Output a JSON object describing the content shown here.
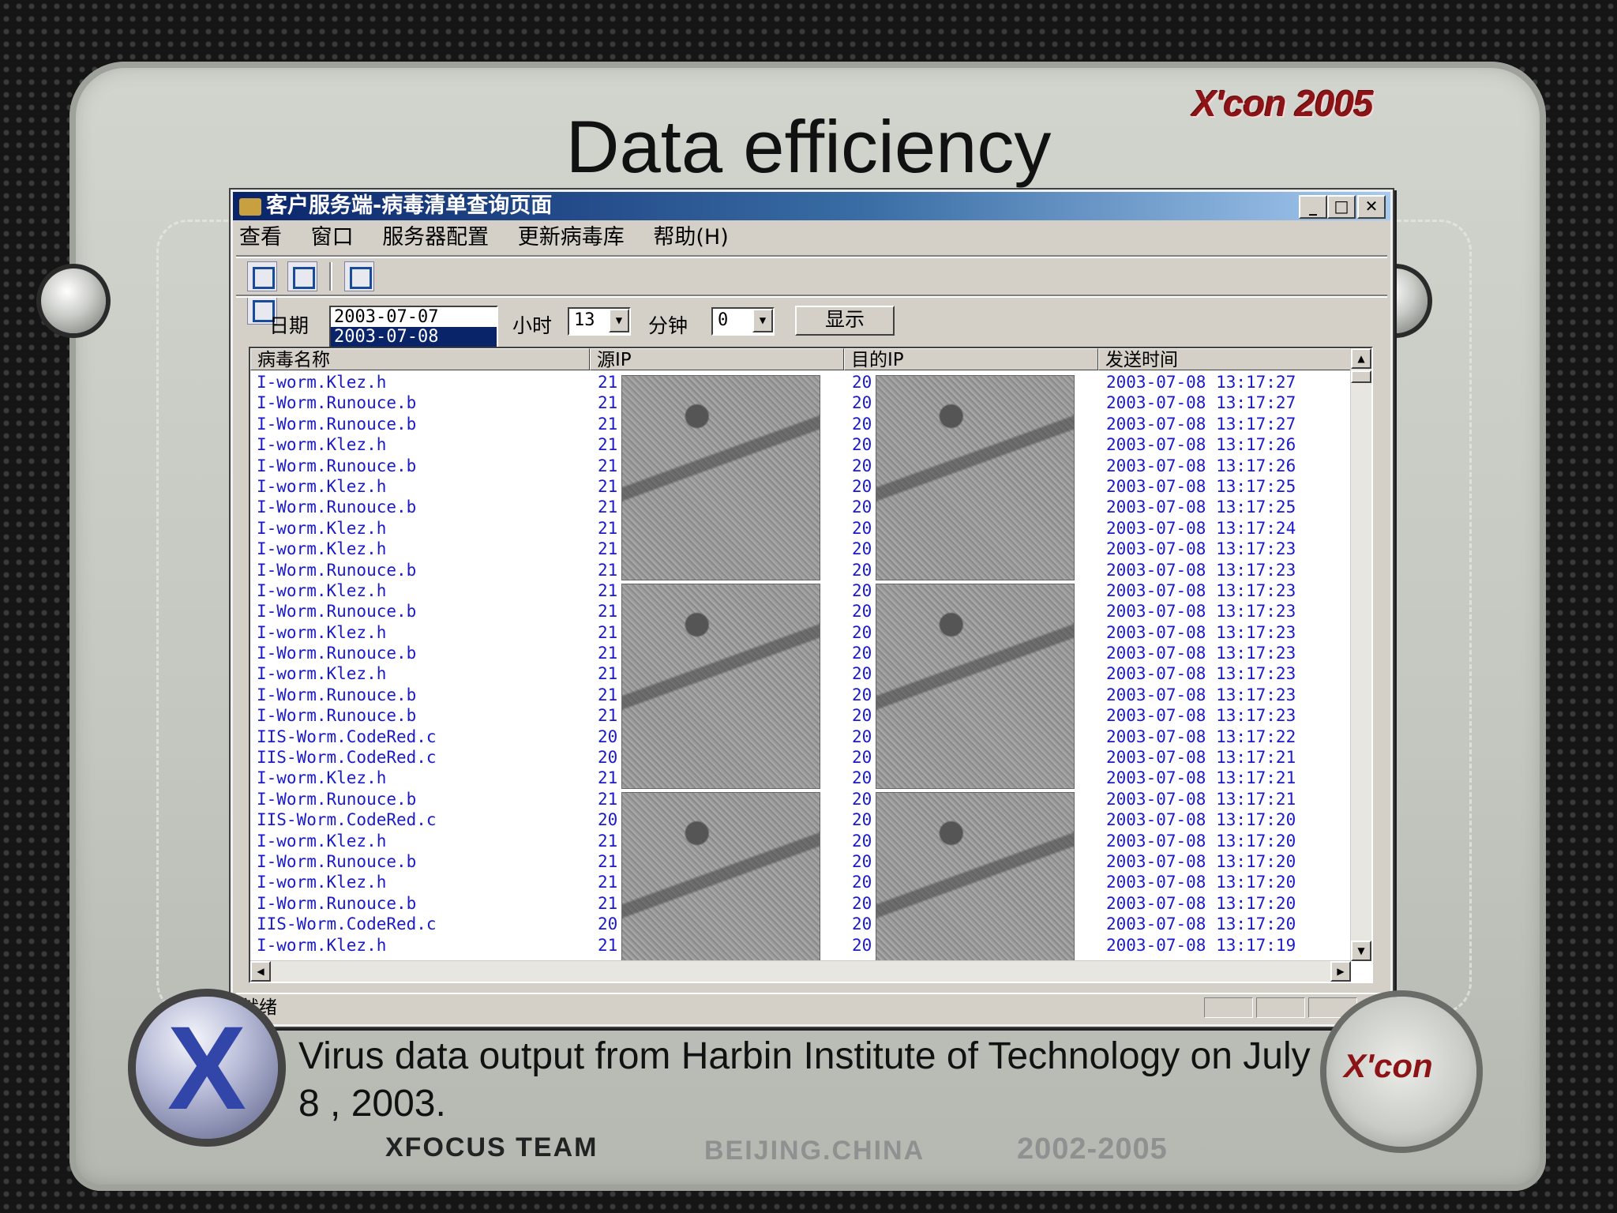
{
  "slide": {
    "title": "Data efficiency",
    "brand_top": "X'con 2005",
    "caption": "Virus data output from Harbin Institute of Technology on July 8 , 2003.",
    "footer_team": "XFOCUS TEAM",
    "footer_city": "BEIJING.CHINA",
    "footer_years": "2002-2005",
    "badge": "X'con",
    "orb": "X"
  },
  "window": {
    "title": "客户服务端-病毒清单查询页面",
    "controls": {
      "minimize": "_",
      "maximize": "□",
      "close": "✕"
    }
  },
  "menu": [
    "查看",
    "窗口",
    "服务器配置",
    "更新病毒库",
    "帮助(H)"
  ],
  "toolbar_icons": [
    "log-icon",
    "search-doc-icon",
    "book-icon",
    "notes-icon"
  ],
  "filter": {
    "date_label": "日期",
    "dates": [
      "2003-07-07",
      "2003-07-08"
    ],
    "selected_date": "2003-07-08",
    "hour_label": "小时",
    "hour_value": "13",
    "minute_label": "分钟",
    "minute_value": "0",
    "show_button": "显示"
  },
  "table": {
    "columns": [
      "病毒名称",
      "源IP",
      "目的IP",
      "发送时间"
    ],
    "rows": [
      {
        "name": "I-worm.Klez.h",
        "src": "21",
        "dst": "20",
        "time": "2003-07-08 13:17:27"
      },
      {
        "name": "I-Worm.Runouce.b",
        "src": "21",
        "dst": "20",
        "time": "2003-07-08 13:17:27"
      },
      {
        "name": "I-Worm.Runouce.b",
        "src": "21",
        "dst": "20",
        "time": "2003-07-08 13:17:27"
      },
      {
        "name": "I-worm.Klez.h",
        "src": "21",
        "dst": "20",
        "time": "2003-07-08 13:17:26"
      },
      {
        "name": "I-Worm.Runouce.b",
        "src": "21",
        "dst": "20",
        "time": "2003-07-08 13:17:26"
      },
      {
        "name": "I-worm.Klez.h",
        "src": "21",
        "dst": "20",
        "time": "2003-07-08 13:17:25"
      },
      {
        "name": "I-Worm.Runouce.b",
        "src": "21",
        "dst": "20",
        "time": "2003-07-08 13:17:25"
      },
      {
        "name": "I-worm.Klez.h",
        "src": "21",
        "dst": "20",
        "time": "2003-07-08 13:17:24"
      },
      {
        "name": "I-worm.Klez.h",
        "src": "21",
        "dst": "20",
        "time": "2003-07-08 13:17:23"
      },
      {
        "name": "I-Worm.Runouce.b",
        "src": "21",
        "dst": "20",
        "time": "2003-07-08 13:17:23"
      },
      {
        "name": "I-worm.Klez.h",
        "src": "21",
        "dst": "20",
        "time": "2003-07-08 13:17:23"
      },
      {
        "name": "I-Worm.Runouce.b",
        "src": "21",
        "dst": "20",
        "time": "2003-07-08 13:17:23"
      },
      {
        "name": "I-worm.Klez.h",
        "src": "21",
        "dst": "20",
        "time": "2003-07-08 13:17:23"
      },
      {
        "name": "I-Worm.Runouce.b",
        "src": "21",
        "dst": "20",
        "time": "2003-07-08 13:17:23"
      },
      {
        "name": "I-worm.Klez.h",
        "src": "21",
        "dst": "20",
        "time": "2003-07-08 13:17:23"
      },
      {
        "name": "I-Worm.Runouce.b",
        "src": "21",
        "dst": "20",
        "time": "2003-07-08 13:17:23"
      },
      {
        "name": "I-Worm.Runouce.b",
        "src": "21",
        "dst": "20",
        "time": "2003-07-08 13:17:23"
      },
      {
        "name": "IIS-Worm.CodeRed.c",
        "src": "20",
        "dst": "20",
        "time": "2003-07-08 13:17:22"
      },
      {
        "name": "IIS-Worm.CodeRed.c",
        "src": "20",
        "dst": "20",
        "time": "2003-07-08 13:17:21"
      },
      {
        "name": "I-worm.Klez.h",
        "src": "21",
        "dst": "20",
        "time": "2003-07-08 13:17:21"
      },
      {
        "name": "I-Worm.Runouce.b",
        "src": "21",
        "dst": "20",
        "time": "2003-07-08 13:17:21"
      },
      {
        "name": "IIS-Worm.CodeRed.c",
        "src": "20",
        "dst": "20",
        "time": "2003-07-08 13:17:20"
      },
      {
        "name": "I-worm.Klez.h",
        "src": "21",
        "dst": "20",
        "time": "2003-07-08 13:17:20"
      },
      {
        "name": "I-Worm.Runouce.b",
        "src": "21",
        "dst": "20",
        "time": "2003-07-08 13:17:20"
      },
      {
        "name": "I-worm.Klez.h",
        "src": "21",
        "dst": "20",
        "time": "2003-07-08 13:17:20"
      },
      {
        "name": "I-Worm.Runouce.b",
        "src": "21",
        "dst": "20",
        "time": "2003-07-08 13:17:20"
      },
      {
        "name": "IIS-Worm.CodeRed.c",
        "src": "20",
        "dst": "20",
        "time": "2003-07-08 13:17:20"
      },
      {
        "name": "I-worm.Klez.h",
        "src": "21",
        "dst": "20",
        "time": "2003-07-08 13:17:19"
      }
    ]
  },
  "status": {
    "text": "就绪"
  },
  "colors": {
    "title_bar": "#0a246a",
    "row_text": "#1a1acc",
    "brand": "#8d1416"
  }
}
